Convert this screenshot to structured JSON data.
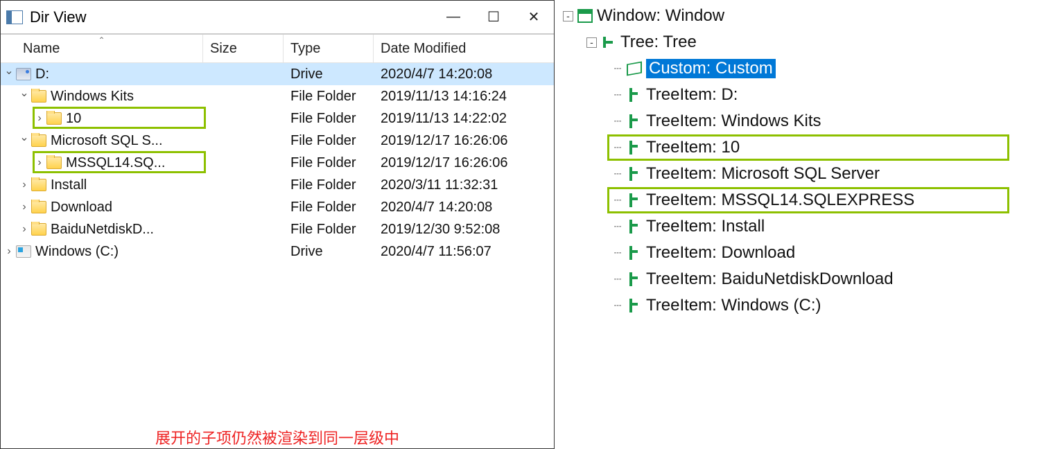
{
  "window": {
    "title": "Dir View",
    "buttons": {
      "min": "—",
      "max": "☐",
      "close": "✕"
    }
  },
  "columns": {
    "name": "Name",
    "size": "Size",
    "type": "Type",
    "date": "Date Modified"
  },
  "rows": [
    {
      "indent": 0,
      "caret": "down",
      "icon": "drive-d",
      "name": "D:",
      "type": "Drive",
      "date": "2020/4/7 14:20:08",
      "selected": true
    },
    {
      "indent": 1,
      "caret": "down",
      "icon": "folder",
      "name": "Windows Kits",
      "type": "File Folder",
      "date": "2019/11/13 14:16:24"
    },
    {
      "indent": 2,
      "caret": "right",
      "icon": "folder",
      "name": "10",
      "type": "File Folder",
      "date": "2019/11/13 14:22:02",
      "hl": true
    },
    {
      "indent": 1,
      "caret": "down",
      "icon": "folder",
      "name": "Microsoft SQL S...",
      "type": "File Folder",
      "date": "2019/12/17 16:26:06"
    },
    {
      "indent": 2,
      "caret": "right",
      "icon": "folder",
      "name": "MSSQL14.SQ...",
      "type": "File Folder",
      "date": "2019/12/17 16:26:06",
      "hl": true
    },
    {
      "indent": 1,
      "caret": "right",
      "icon": "folder",
      "name": "Install",
      "type": "File Folder",
      "date": "2020/3/11 11:32:31"
    },
    {
      "indent": 1,
      "caret": "right",
      "icon": "folder",
      "name": "Download",
      "type": "File Folder",
      "date": "2020/4/7 14:20:08"
    },
    {
      "indent": 1,
      "caret": "right",
      "icon": "folder",
      "name": "BaiduNetdiskD...",
      "type": "File Folder",
      "date": "2019/12/30 9:52:08"
    },
    {
      "indent": 0,
      "caret": "right",
      "icon": "drive-c",
      "name": "Windows  (C:)",
      "type": "Drive",
      "date": "2020/4/7 11:56:07"
    }
  ],
  "annotation": "展开的子项仍然被渲染到同一层级中",
  "tree": [
    {
      "indent": 0,
      "expander": "-",
      "icon": "window",
      "label": "Window: Window"
    },
    {
      "indent": 1,
      "expander": "-",
      "icon": "treeic",
      "label": "Tree: Tree"
    },
    {
      "indent": 2,
      "expander": "",
      "icon": "custom",
      "label": "Custom: Custom",
      "selected": true
    },
    {
      "indent": 2,
      "expander": "",
      "icon": "treeitem",
      "label": "TreeItem: D:"
    },
    {
      "indent": 2,
      "expander": "",
      "icon": "treeitem",
      "label": "TreeItem: Windows Kits"
    },
    {
      "indent": 2,
      "expander": "",
      "icon": "treeitem",
      "label": "TreeItem: 10",
      "hl": true
    },
    {
      "indent": 2,
      "expander": "",
      "icon": "treeitem",
      "label": "TreeItem: Microsoft SQL Server"
    },
    {
      "indent": 2,
      "expander": "",
      "icon": "treeitem",
      "label": "TreeItem: MSSQL14.SQLEXPRESS",
      "hl": true
    },
    {
      "indent": 2,
      "expander": "",
      "icon": "treeitem",
      "label": "TreeItem: Install"
    },
    {
      "indent": 2,
      "expander": "",
      "icon": "treeitem",
      "label": "TreeItem: Download"
    },
    {
      "indent": 2,
      "expander": "",
      "icon": "treeitem",
      "label": "TreeItem: BaiduNetdiskDownload"
    },
    {
      "indent": 2,
      "expander": "",
      "icon": "treeitem",
      "label": "TreeItem: Windows  (C:)"
    }
  ]
}
